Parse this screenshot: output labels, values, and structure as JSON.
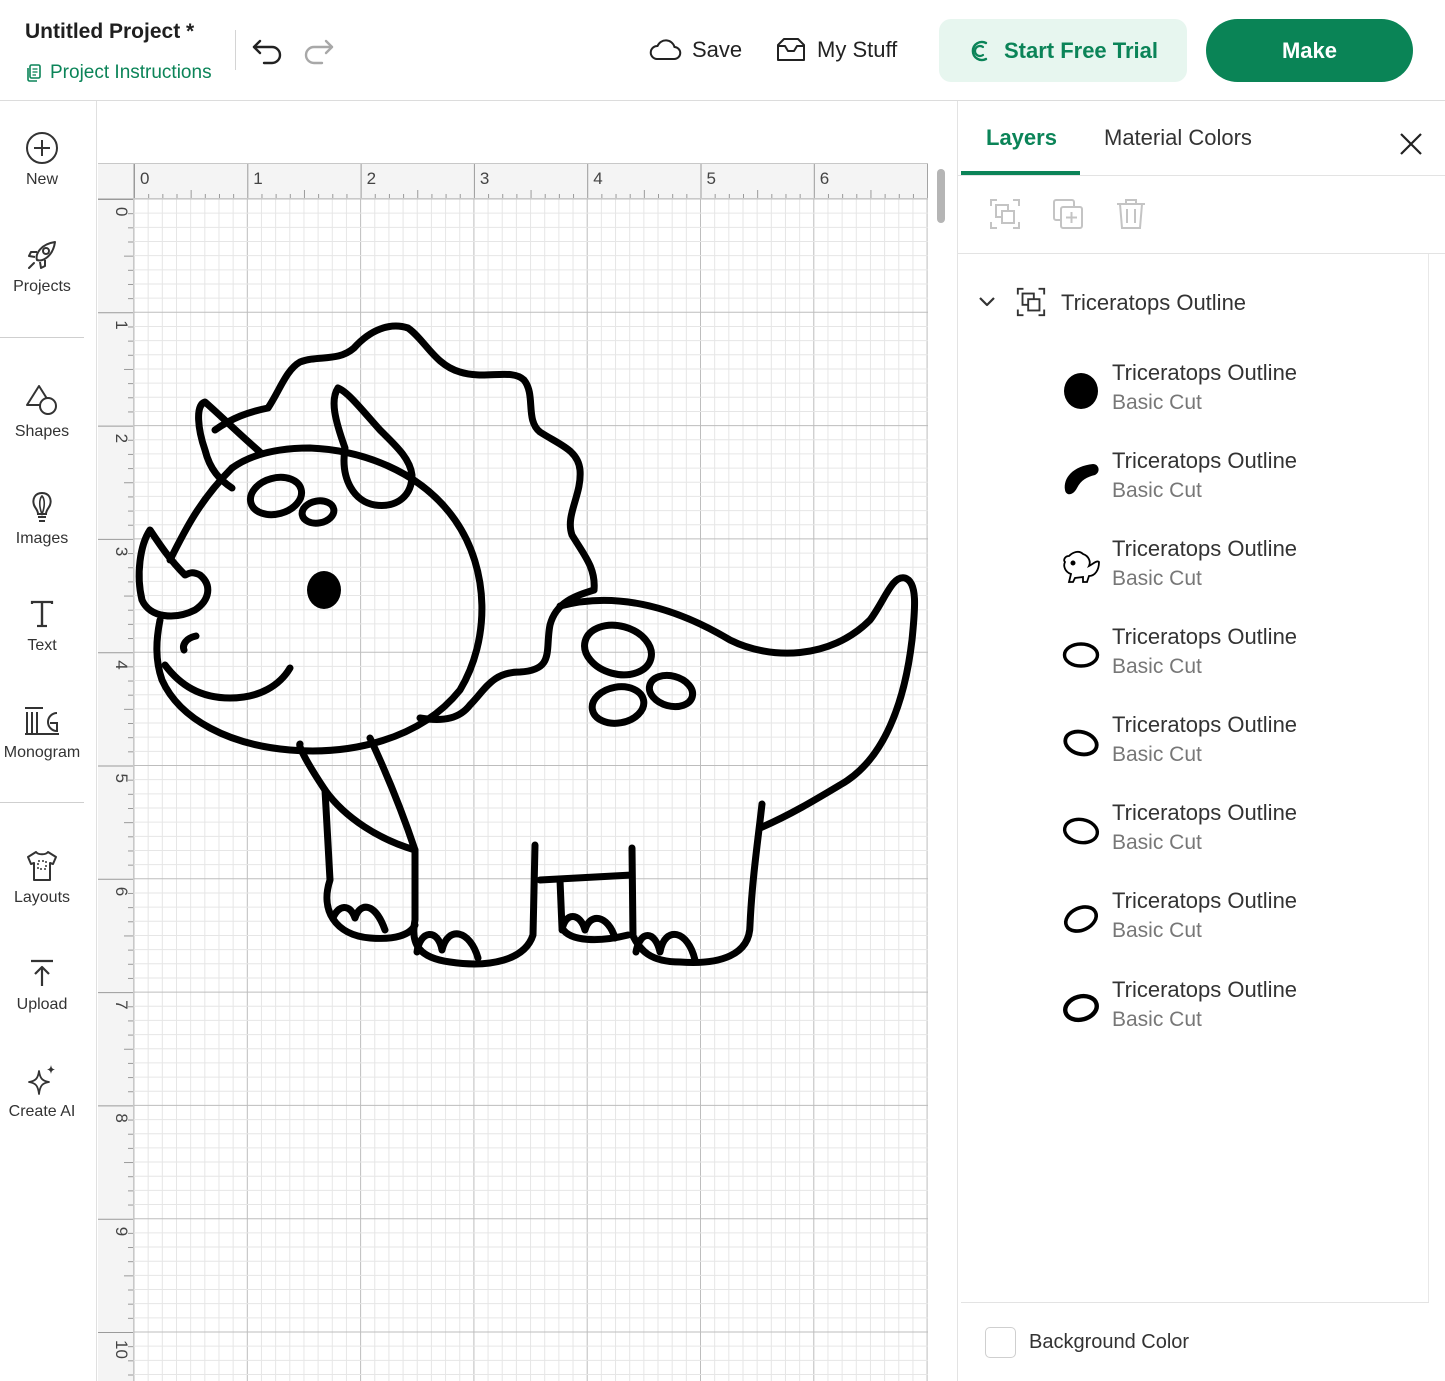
{
  "header": {
    "project_title": "Untitled Project *",
    "project_instructions": "Project Instructions",
    "save_label": "Save",
    "my_stuff_label": "My Stuff",
    "trial_label": "Start Free Trial",
    "make_label": "Make",
    "accent_color": "#0a8456"
  },
  "sidebar": {
    "items": [
      {
        "label": "New",
        "icon": "plus-circle-icon"
      },
      {
        "label": "Projects",
        "icon": "rocket-icon"
      },
      {
        "label": "Shapes",
        "icon": "shapes-icon"
      },
      {
        "label": "Images",
        "icon": "lightbulb-icon"
      },
      {
        "label": "Text",
        "icon": "text-icon"
      },
      {
        "label": "Monogram",
        "icon": "monogram-icon"
      },
      {
        "label": "Layouts",
        "icon": "shirt-icon"
      },
      {
        "label": "Upload",
        "icon": "upload-icon"
      },
      {
        "label": "Create AI",
        "icon": "sparkle-icon"
      }
    ]
  },
  "canvas": {
    "ruler_units": "in",
    "h_ruler_labels": [
      "0",
      "1",
      "2",
      "3",
      "4",
      "5",
      "6"
    ],
    "v_ruler_labels": [
      "0",
      "1",
      "2",
      "3",
      "4",
      "5",
      "6",
      "7",
      "8",
      "9",
      "10"
    ],
    "design": "triceratops-outline"
  },
  "panel": {
    "tabs": [
      {
        "label": "Layers",
        "active": true
      },
      {
        "label": "Material Colors",
        "active": false
      }
    ],
    "group_name": "Triceratops Outline",
    "layers": [
      {
        "name": "Triceratops Outline",
        "operation": "Basic Cut",
        "thumb": "filled-circle"
      },
      {
        "name": "Triceratops Outline",
        "operation": "Basic Cut",
        "thumb": "filled-comma"
      },
      {
        "name": "Triceratops Outline",
        "operation": "Basic Cut",
        "thumb": "dino-outline"
      },
      {
        "name": "Triceratops Outline",
        "operation": "Basic Cut",
        "thumb": "ellipse"
      },
      {
        "name": "Triceratops Outline",
        "operation": "Basic Cut",
        "thumb": "ellipse"
      },
      {
        "name": "Triceratops Outline",
        "operation": "Basic Cut",
        "thumb": "ellipse"
      },
      {
        "name": "Triceratops Outline",
        "operation": "Basic Cut",
        "thumb": "ellipse"
      },
      {
        "name": "Triceratops Outline",
        "operation": "Basic Cut",
        "thumb": "ellipse"
      }
    ],
    "background_color_label": "Background Color"
  }
}
